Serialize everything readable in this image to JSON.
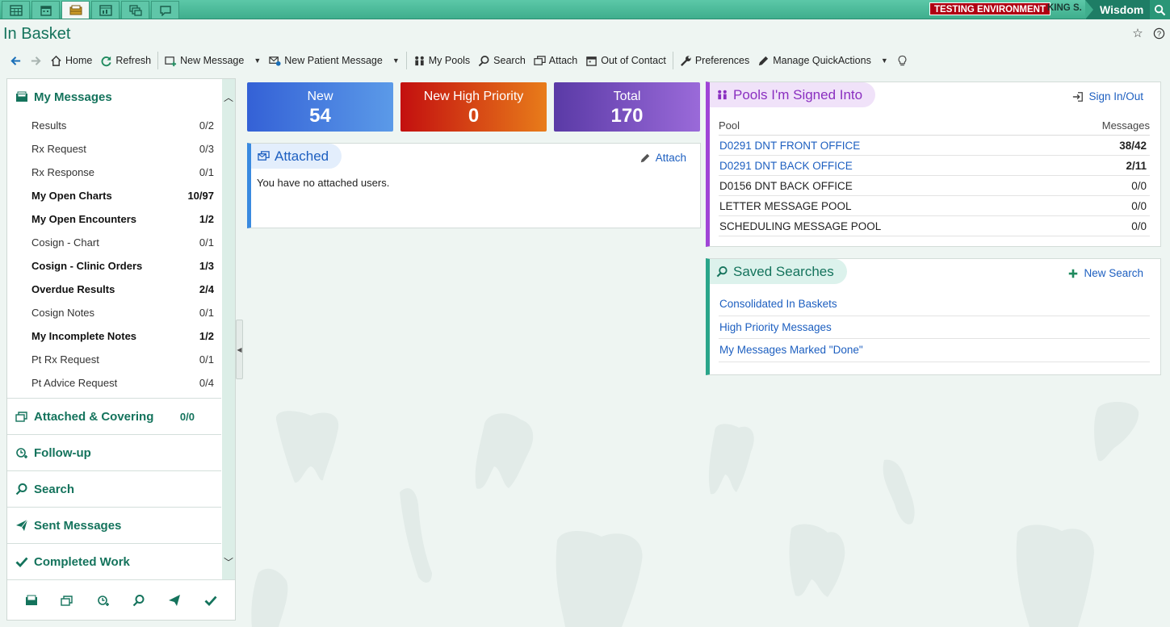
{
  "topbar": {
    "tabs": [
      {
        "icon": "schedule-grid-icon",
        "active": false
      },
      {
        "icon": "calendar-icon",
        "active": false
      },
      {
        "icon": "inbasket-tray-icon",
        "active": true
      },
      {
        "icon": "chart-window-icon",
        "active": false
      },
      {
        "icon": "stacked-windows-icon",
        "active": false
      },
      {
        "icon": "chat-bubble-icon",
        "active": false
      }
    ],
    "environment_label": "TESTING ENVIRONMENT",
    "user_label": "KING S.",
    "app_label": "Wisdom"
  },
  "page": {
    "title": "In Basket"
  },
  "toolbar": {
    "home": "Home",
    "refresh": "Refresh",
    "new_message": "New Message",
    "new_patient_message": "New Patient Message",
    "my_pools": "My Pools",
    "search": "Search",
    "attach": "Attach",
    "out_of_contact": "Out of Contact",
    "preferences": "Preferences",
    "manage_quickactions": "Manage QuickActions"
  },
  "nav": {
    "my_messages": {
      "label": "My Messages",
      "items": [
        {
          "label": "Results",
          "count": "0/2",
          "bold": false
        },
        {
          "label": "Rx Request",
          "count": "0/3",
          "bold": false
        },
        {
          "label": "Rx Response",
          "count": "0/1",
          "bold": false
        },
        {
          "label": "My Open Charts",
          "count": "10/97",
          "bold": true
        },
        {
          "label": "My Open Encounters",
          "count": "1/2",
          "bold": true
        },
        {
          "label": "Cosign - Chart",
          "count": "0/1",
          "bold": false
        },
        {
          "label": "Cosign - Clinic Orders",
          "count": "1/3",
          "bold": true
        },
        {
          "label": "Overdue Results",
          "count": "2/4",
          "bold": true
        },
        {
          "label": "Cosign Notes",
          "count": "0/1",
          "bold": false
        },
        {
          "label": "My Incomplete Notes",
          "count": "1/2",
          "bold": true
        },
        {
          "label": "Pt Rx Request",
          "count": "0/1",
          "bold": false
        },
        {
          "label": "Pt Advice Request",
          "count": "0/4",
          "bold": false
        }
      ]
    },
    "attached_covering": {
      "label": "Attached & Covering",
      "count": "0/0"
    },
    "follow_up": {
      "label": "Follow-up"
    },
    "search": {
      "label": "Search"
    },
    "sent_messages": {
      "label": "Sent Messages"
    },
    "completed_work": {
      "label": "Completed Work"
    }
  },
  "tiles": {
    "new": {
      "label": "New",
      "value": "54"
    },
    "high_priority": {
      "label": "New High Priority",
      "value": "0"
    },
    "total": {
      "label": "Total",
      "value": "170"
    }
  },
  "attached": {
    "title": "Attached",
    "action": "Attach",
    "message": "You have no attached users."
  },
  "pools": {
    "title": "Pools I'm Signed Into",
    "action": "Sign In/Out",
    "col_pool": "Pool",
    "col_messages": "Messages",
    "rows": [
      {
        "name": "D0291 DNT FRONT OFFICE",
        "messages": "38/42",
        "link": true,
        "strong": true
      },
      {
        "name": "D0291 DNT BACK OFFICE",
        "messages": "2/11",
        "link": true,
        "strong": true
      },
      {
        "name": "D0156 DNT BACK OFFICE",
        "messages": "0/0",
        "link": false,
        "strong": false
      },
      {
        "name": "LETTER MESSAGE POOL",
        "messages": "0/0",
        "link": false,
        "strong": false
      },
      {
        "name": "SCHEDULING MESSAGE POOL",
        "messages": "0/0",
        "link": false,
        "strong": false
      }
    ]
  },
  "saved_searches": {
    "title": "Saved Searches",
    "action": "New Search",
    "items": [
      "Consolidated In Baskets",
      "High Priority Messages",
      "My Messages Marked \"Done\""
    ]
  },
  "colors": {
    "brand_green": "#14735c",
    "link_blue": "#1d5fc0",
    "testing_red": "#b00012"
  }
}
